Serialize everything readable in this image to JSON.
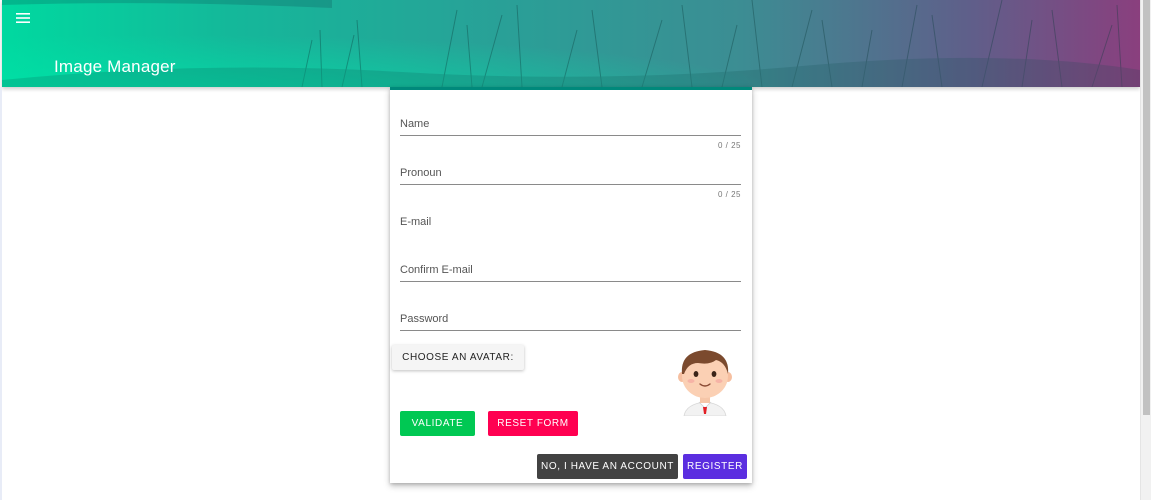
{
  "header": {
    "title": "Image Manager",
    "menu_icon": "hamburger-menu-icon",
    "colors": {
      "gradient_start": "#00d9a0",
      "gradient_end": "#8a3f7e"
    }
  },
  "form": {
    "accent_color": "#00897b",
    "fields": {
      "name": {
        "label": "Name",
        "counter": "0 / 25"
      },
      "pronoun": {
        "label": "Pronoun",
        "counter": "0 / 25"
      },
      "email": {
        "label": "E-mail"
      },
      "confirm_email": {
        "label": "Confirm E-mail"
      },
      "password": {
        "label": "Password"
      }
    },
    "choose_avatar_label": "Choose an avatar:",
    "avatar_icon": "cartoon-avatar-icon",
    "buttons": {
      "validate": {
        "label": "Validate",
        "color": "#00c853"
      },
      "reset": {
        "label": "Reset Form",
        "color": "#ff0051"
      },
      "have_account": {
        "label": "No, I have an account",
        "color": "#424242"
      },
      "register": {
        "label": "Register",
        "color": "#5b2ee0"
      }
    }
  }
}
